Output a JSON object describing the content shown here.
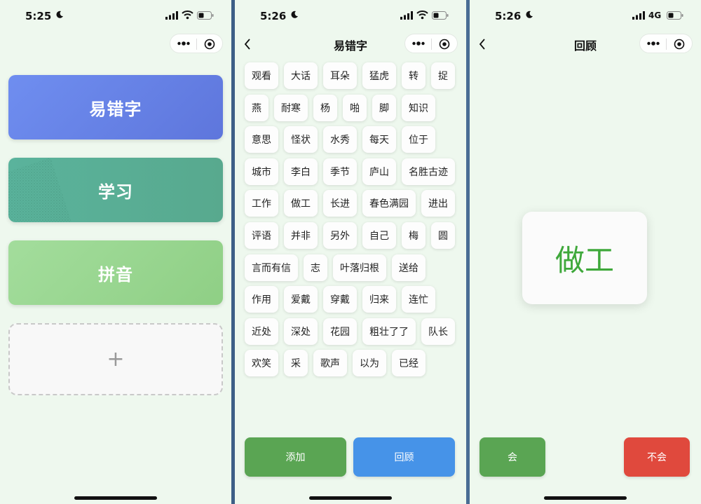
{
  "screens": [
    {
      "status": {
        "time": "5:25"
      },
      "cards": [
        {
          "label": "易错字"
        },
        {
          "label": "学习"
        },
        {
          "label": "拼音"
        }
      ],
      "add_card": {
        "label": "+"
      }
    },
    {
      "status": {
        "time": "5:26"
      },
      "nav": {
        "title": "易错字"
      },
      "words": [
        "观看",
        "大话",
        "耳朵",
        "猛虎",
        "转",
        "捉",
        "燕",
        "耐寒",
        "杨",
        "啪",
        "脚",
        "知识",
        "意思",
        "怪状",
        "水秀",
        "每天",
        "位于",
        "城市",
        "李白",
        "季节",
        "庐山",
        "名胜古迹",
        "工作",
        "做工",
        "长进",
        "春色满园",
        "进出",
        "评语",
        "并非",
        "另外",
        "自己",
        "梅",
        "圆",
        "言而有信",
        "志",
        "叶落归根",
        "送给",
        "作用",
        "爱戴",
        "穿戴",
        "归来",
        "连忙",
        "近处",
        "深处",
        "花园",
        "粗壮了了",
        "队长",
        "欢笑",
        "采",
        "歌声",
        "以为",
        "已经"
      ],
      "buttons": {
        "add": "添加",
        "review": "回顾"
      }
    },
    {
      "status": {
        "time": "5:26",
        "network": "4G"
      },
      "nav": {
        "title": "回顾"
      },
      "flashcard": {
        "word": "做工"
      },
      "buttons": {
        "know": "会",
        "dont_know": "不会"
      }
    }
  ],
  "colors": {
    "background": "#eef8ee",
    "card_primary": "#6f8ef0",
    "card_study": "#5ab39c",
    "card_pinyin": "#a3dd9c",
    "button_green": "#5aa553",
    "button_blue": "#4693e8",
    "button_red": "#e0493d",
    "flashcard_text": "#3ea83a"
  },
  "icons": [
    "moon-icon",
    "signal-icon",
    "wifi-icon",
    "battery-icon",
    "more-dots-icon",
    "record-icon",
    "back-chevron-icon"
  ]
}
